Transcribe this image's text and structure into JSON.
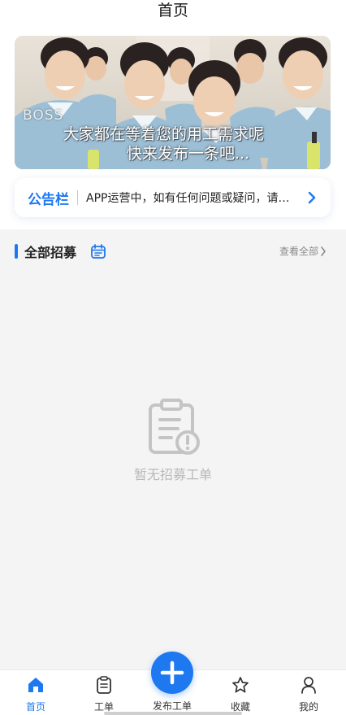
{
  "header": {
    "title": "首页"
  },
  "banner": {
    "overlay_small": "BOSS",
    "overlay_line1": "大家都在等着您的用工需求呢",
    "overlay_line2": "快来发布一条吧..."
  },
  "notice": {
    "title": "公告栏",
    "text": "APP运营中，如有任何问题或疑问，请联系客服"
  },
  "section": {
    "title": "全部招募",
    "view_all": "查看全部",
    "empty_text": "暂无招募工单"
  },
  "tabbar": {
    "home": "首页",
    "orders": "工单",
    "publish": "发布工单",
    "favorites": "收藏",
    "mine": "我的"
  },
  "colors": {
    "accent": "#1e78f0",
    "muted_text": "#b9b9b9",
    "background": "#f4f4f5"
  },
  "icons": [
    "calendar-icon",
    "chevron-right-icon",
    "clipboard-alert-icon",
    "home-icon",
    "clipboard-icon",
    "plus-icon",
    "star-icon",
    "user-icon"
  ]
}
